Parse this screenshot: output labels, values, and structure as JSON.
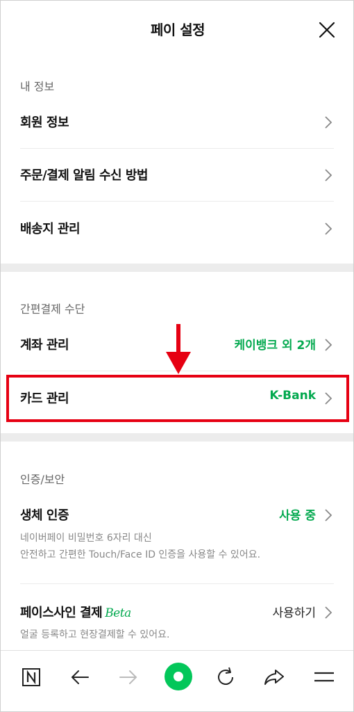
{
  "header": {
    "title": "페이 설정"
  },
  "my_info": {
    "section": "내 정보",
    "items": [
      {
        "label": "회원 정보"
      },
      {
        "label": "주문/결제 알림 수신 방법"
      },
      {
        "label": "배송지 관리"
      }
    ]
  },
  "payment": {
    "section": "간편결제 수단",
    "account": {
      "label": "계좌 관리",
      "value": "케이뱅크 외 2개"
    },
    "card": {
      "label": "카드 관리",
      "value": "K-Bank"
    }
  },
  "security": {
    "section": "인증/보안",
    "biometric": {
      "label": "생체 인증",
      "value": "사용 중",
      "desc1": "네이버페이 비밀번호 6자리 대신",
      "desc2": "안전하고 간편한 Touch/Face ID 인증을 사용할 수 있어요."
    },
    "facesign": {
      "label": "페이스사인 결제",
      "badge": "Beta",
      "value": "사용하기",
      "desc": "얼굴 등록하고 현장결제할 수 있어요."
    }
  },
  "colors": {
    "accent": "#03a94f",
    "highlight": "#e60012"
  },
  "bottom_nav": [
    "naver-home-icon",
    "back-icon",
    "forward-icon",
    "home-circle-icon",
    "refresh-icon",
    "share-icon",
    "menu-icon"
  ]
}
